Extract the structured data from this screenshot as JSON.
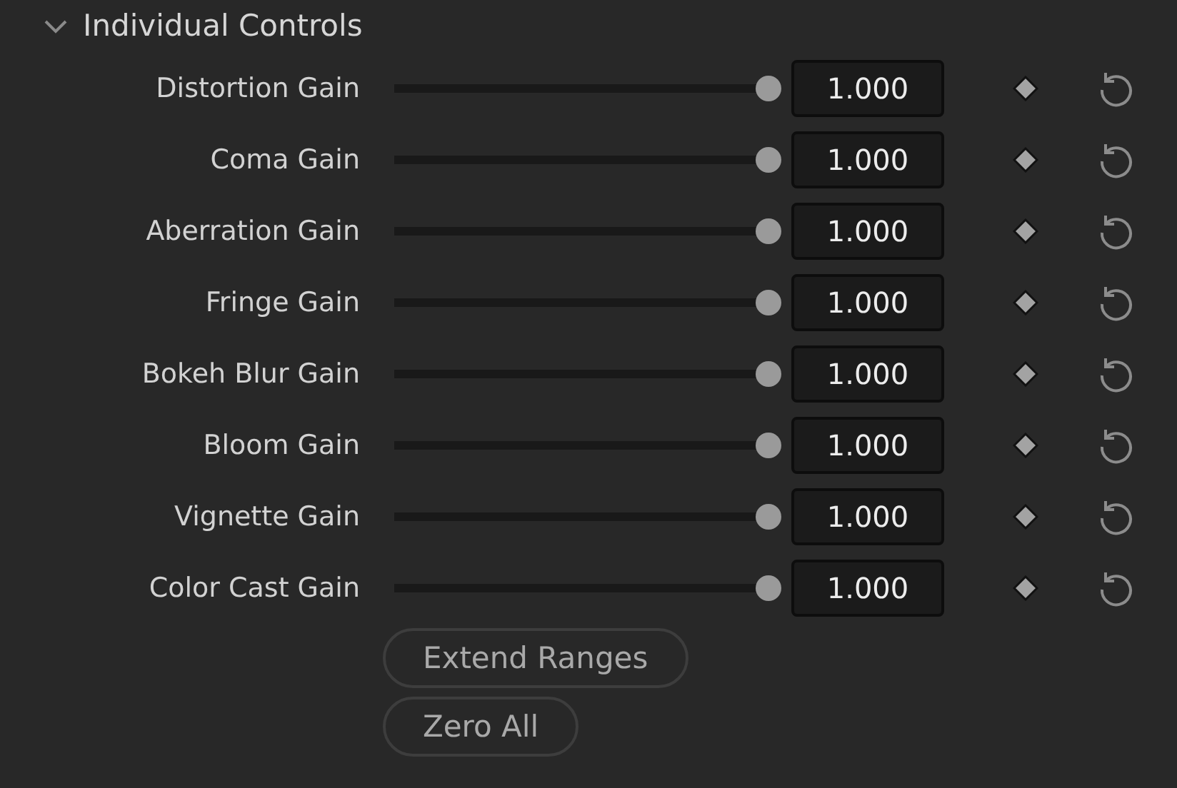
{
  "section": {
    "title": "Individual Controls",
    "expanded": true
  },
  "controls": [
    {
      "label": "Distortion Gain",
      "level": 1.0,
      "value": "1.000"
    },
    {
      "label": "Coma Gain",
      "level": 1.0,
      "value": "1.000"
    },
    {
      "label": "Aberration Gain",
      "level": 1.0,
      "value": "1.000"
    },
    {
      "label": "Fringe Gain",
      "level": 1.0,
      "value": "1.000"
    },
    {
      "label": "Bokeh Blur Gain",
      "level": 1.0,
      "value": "1.000"
    },
    {
      "label": "Bloom Gain",
      "level": 1.0,
      "value": "1.000"
    },
    {
      "label": "Vignette Gain",
      "level": 1.0,
      "value": "1.000"
    },
    {
      "label": "Color Cast Gain",
      "level": 1.0,
      "value": "1.000"
    }
  ],
  "buttons": [
    "Extend Ranges",
    "Zero All"
  ]
}
